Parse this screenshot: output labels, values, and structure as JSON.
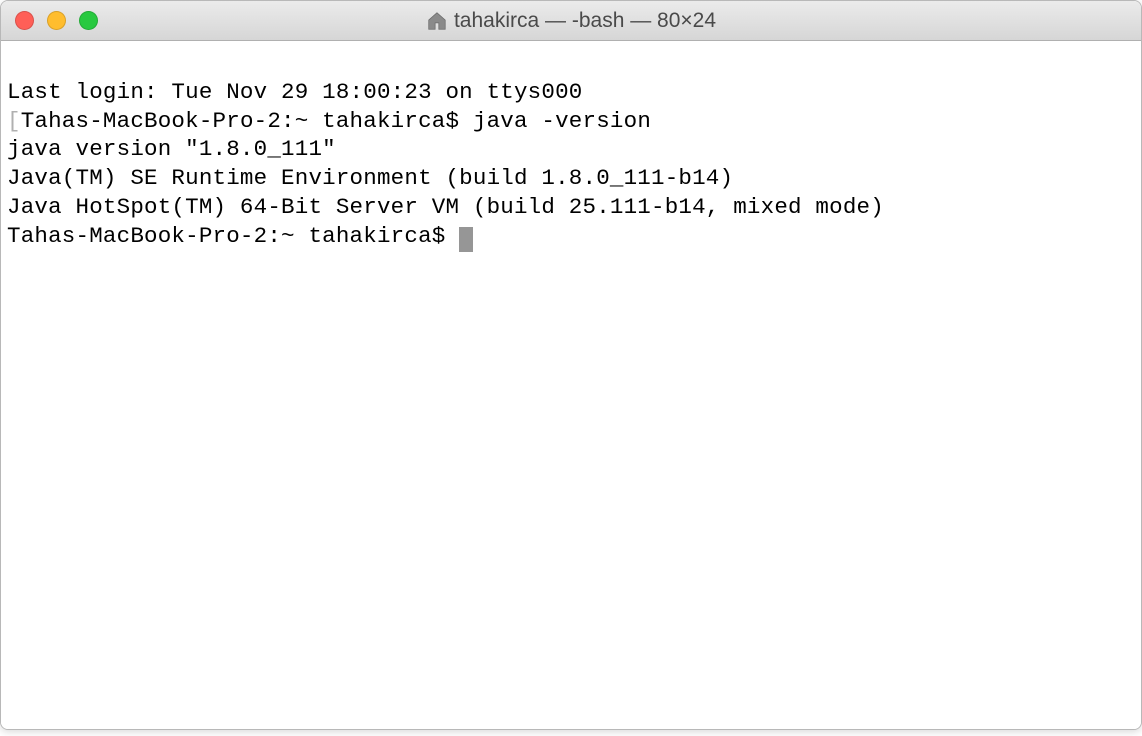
{
  "window": {
    "title": "tahakirca — -bash — 80×24"
  },
  "terminal": {
    "line1": "Last login: Tue Nov 29 18:00:23 on ttys000",
    "line2_prompt": "Tahas-MacBook-Pro-2:~ tahakirca$ ",
    "line2_cmd": "java -version",
    "line3": "java version \"1.8.0_111\"",
    "line4": "Java(TM) SE Runtime Environment (build 1.8.0_111-b14)",
    "line5": "Java HotSpot(TM) 64-Bit Server VM (build 25.111-b14, mixed mode)",
    "line6_prompt": "Tahas-MacBook-Pro-2:~ tahakirca$ "
  }
}
